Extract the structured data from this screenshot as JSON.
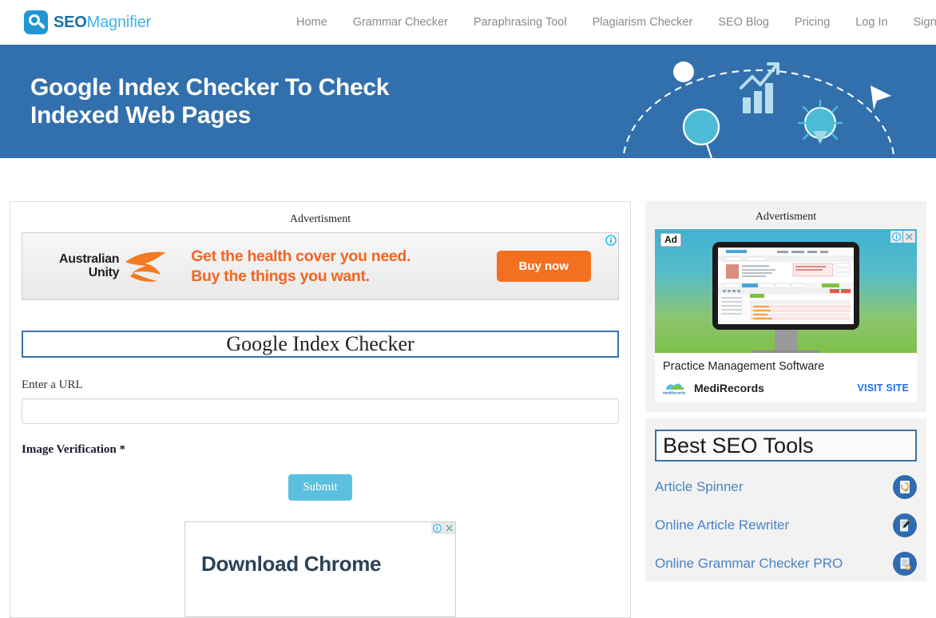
{
  "header": {
    "logo": {
      "primary": "SEO",
      "secondary": "Magnifier"
    },
    "nav": [
      {
        "label": "Home"
      },
      {
        "label": "Grammar Checker"
      },
      {
        "label": "Paraphrasing Tool"
      },
      {
        "label": "Plagiarism Checker"
      },
      {
        "label": "SEO Blog"
      },
      {
        "label": "Pricing"
      },
      {
        "label": "Log In"
      },
      {
        "label": "Sign Up"
      }
    ]
  },
  "hero": {
    "title_line1": "Google Index Checker To Check",
    "title_line2": "Indexed Web Pages",
    "bg_color": "#3270ad"
  },
  "main": {
    "ad_label": "Advertisment",
    "banner_ad": {
      "brand_line1": "Australian",
      "brand_line2": "Unity",
      "headline_line1": "Get the health cover you need.",
      "headline_line2": "Buy the things you want.",
      "cta": "Buy now",
      "accent_color": "#f37021"
    },
    "tool_title": "Google Index Checker",
    "url_field": {
      "label": "Enter a URL",
      "value": "",
      "placeholder": ""
    },
    "verification_label": "Image Verification *",
    "submit_label": "Submit",
    "chrome_ad": {
      "title": "Download Chrome"
    }
  },
  "sidebar": {
    "ad_label": "Advertisment",
    "ad": {
      "tag": "Ad",
      "headline": "Practice Management Software",
      "brand": "MediRecords",
      "cta": "VISIT SITE"
    },
    "tools": {
      "title": "Best SEO Tools",
      "items": [
        {
          "label": "Article Spinner",
          "icon": "article-spinner-icon"
        },
        {
          "label": "Online Article Rewriter",
          "icon": "article-rewriter-icon"
        },
        {
          "label": "Online Grammar Checker PRO",
          "icon": "grammar-checker-icon"
        }
      ]
    }
  }
}
